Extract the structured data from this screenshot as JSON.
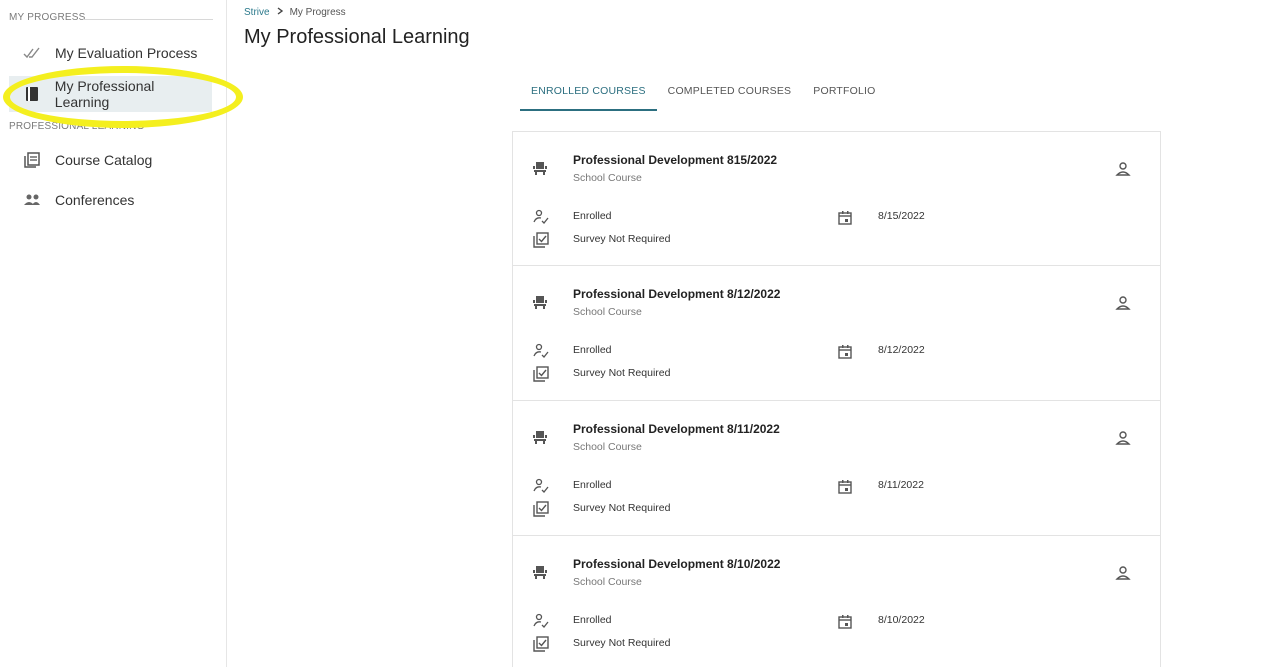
{
  "sidebar": {
    "section_progress": "MY PROGRESS",
    "section_learning": "PROFESSIONAL LEARNING",
    "items": [
      {
        "label": "My Evaluation Process",
        "icon": "double-check-icon"
      },
      {
        "label": "My Professional Learning",
        "icon": "book-icon"
      },
      {
        "label": "Course Catalog",
        "icon": "catalog-icon"
      },
      {
        "label": "Conferences",
        "icon": "people-icon"
      }
    ],
    "highlight_color": "#f4ef1f"
  },
  "breadcrumb": {
    "home": "Strive",
    "separator": ">",
    "current": "My Progress"
  },
  "page": {
    "title": "My Professional Learning"
  },
  "tabs": [
    {
      "label": "ENROLLED COURSES",
      "active": true
    },
    {
      "label": "COMPLETED COURSES",
      "active": false
    },
    {
      "label": "PORTFOLIO",
      "active": false
    }
  ],
  "courses": [
    {
      "title": "Professional Development 815/2022",
      "type": "School Course",
      "status": "Enrolled",
      "survey": "Survey Not Required",
      "date": "8/15/2022"
    },
    {
      "title": "Professional Development 8/12/2022",
      "type": "School Course",
      "status": "Enrolled",
      "survey": "Survey Not Required",
      "date": "8/12/2022"
    },
    {
      "title": "Professional Development 8/11/2022",
      "type": "School Course",
      "status": "Enrolled",
      "survey": "Survey Not Required",
      "date": "8/11/2022"
    },
    {
      "title": "Professional Development 8/10/2022",
      "type": "School Course",
      "status": "Enrolled",
      "survey": "Survey Not Required",
      "date": "8/10/2022"
    }
  ],
  "colors": {
    "accent": "#2c6f80",
    "active_nav_bg": "#e8eef0"
  }
}
